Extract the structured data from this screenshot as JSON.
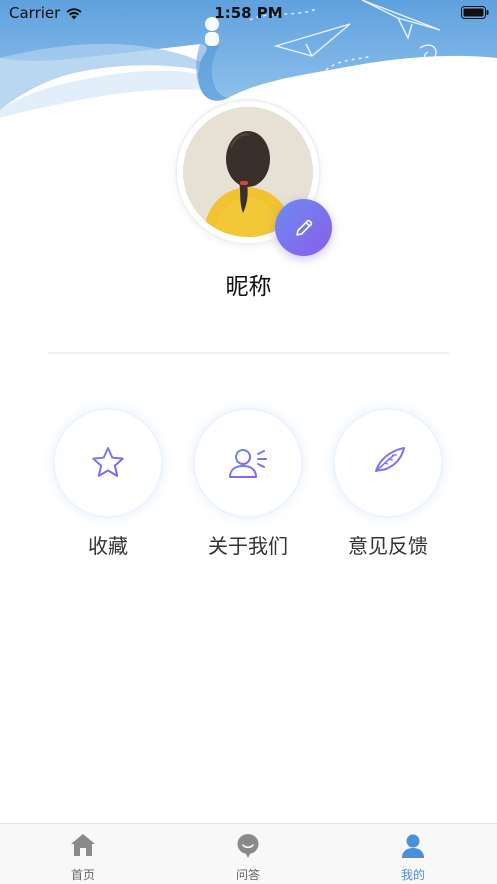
{
  "status_bar": {
    "carrier": "Carrier",
    "time": "1:58 PM"
  },
  "profile": {
    "nickname": "昵称"
  },
  "features": [
    {
      "label": "收藏",
      "icon": "star-icon"
    },
    {
      "label": "关于我们",
      "icon": "about-us-icon"
    },
    {
      "label": "意见反馈",
      "icon": "feedback-quill-icon"
    }
  ],
  "tab_bar": {
    "items": [
      {
        "label": "首页",
        "icon": "home-icon"
      },
      {
        "label": "问答",
        "icon": "chat-bubble-icon"
      },
      {
        "label": "我的",
        "icon": "person-icon",
        "active": true
      }
    ]
  },
  "colors": {
    "header_blue": "#6aa9e0",
    "accent_purple": "#7b6ce6",
    "active_tab": "#4a90d8"
  }
}
